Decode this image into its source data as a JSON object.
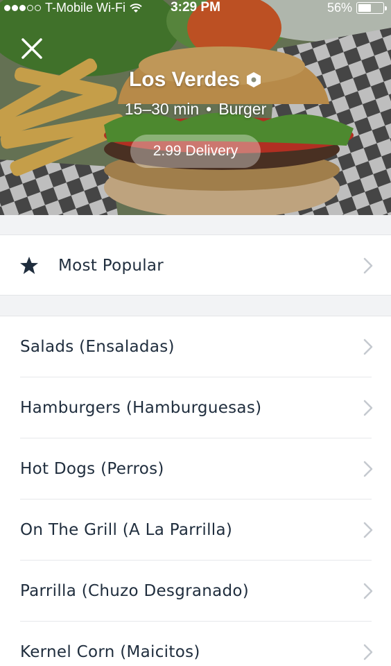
{
  "status_bar": {
    "carrier": "T-Mobile Wi-Fi",
    "time": "3:29 PM",
    "battery": "56%",
    "battery_level": 0.56
  },
  "restaurant": {
    "name": "Los Verdes",
    "eta": "15–30 min",
    "separator": "•",
    "cuisine": "Burger",
    "delivery_fee": "2.99 Delivery"
  },
  "popular": {
    "label": "Most Popular",
    "icon": "star-icon"
  },
  "categories": [
    {
      "label": "Salads (Ensaladas)"
    },
    {
      "label": "Hamburgers (Hamburguesas)"
    },
    {
      "label": "Hot Dogs (Perros)"
    },
    {
      "label": "On The Grill (A La Parrilla)"
    },
    {
      "label": "Parrilla (Chuzo Desgranado)"
    },
    {
      "label": "Kernel Corn (Maicitos)"
    }
  ],
  "colors": {
    "text": "#1f2d3d",
    "chevron": "#c4c9cf",
    "background": "#f2f3f5"
  }
}
